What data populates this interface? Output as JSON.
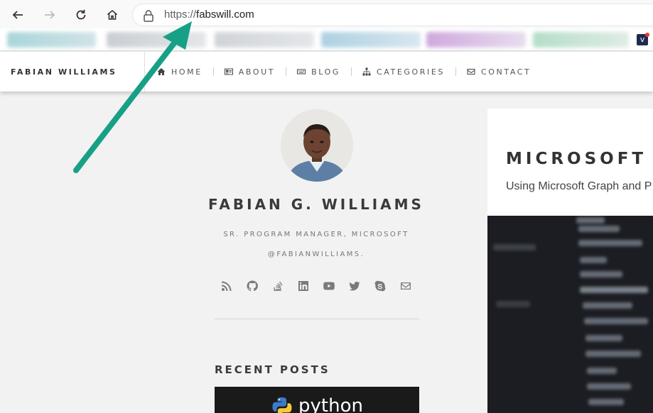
{
  "browser": {
    "url_scheme": "https://",
    "url_host": "fabswill.com"
  },
  "site": {
    "brand": "FABIAN WILLIAMS",
    "nav": [
      {
        "label": "HOME",
        "icon": "home-icon"
      },
      {
        "label": "ABOUT",
        "icon": "id-card-icon"
      },
      {
        "label": "BLOG",
        "icon": "keyboard-icon"
      },
      {
        "label": "CATEGORIES",
        "icon": "sitemap-icon"
      },
      {
        "label": "CONTACT",
        "icon": "envelope-icon"
      }
    ]
  },
  "profile": {
    "name": "FABIAN G. WILLIAMS",
    "title": "SR. PROGRAM MANAGER, MICROSOFT",
    "handle": "@FABIANWILLIAMS.",
    "social_icons": [
      "rss-icon",
      "github-icon",
      "stackoverflow-icon",
      "linkedin-icon",
      "youtube-icon",
      "twitter-icon",
      "skype-icon",
      "envelope-icon"
    ]
  },
  "sidebar": {
    "recent_posts_heading": "RECENT POSTS",
    "recent_post_thumb_text": "python"
  },
  "post": {
    "title": "MICROSOFT",
    "subtitle": "Using Microsoft Graph and P"
  },
  "colors": {
    "arrow": "#17a085",
    "page_bg": "#f2f2f2"
  }
}
